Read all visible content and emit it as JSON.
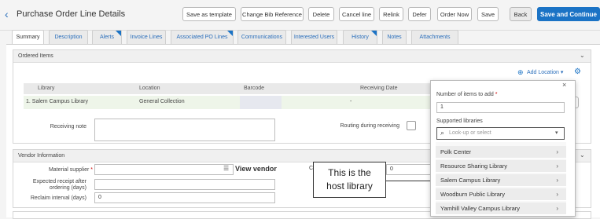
{
  "header": {
    "title": "Purchase Order Line Details",
    "buttons": {
      "save_as_template": "Save as template",
      "change_bib": "Change Bib Reference",
      "delete": "Delete",
      "cancel_line": "Cancel line",
      "relink": "Relink",
      "defer": "Defer",
      "order_now": "Order Now",
      "save": "Save",
      "back": "Back",
      "save_continue": "Save and Continue"
    }
  },
  "tabs": [
    {
      "label": "Summary",
      "active": true
    },
    {
      "label": "Description"
    },
    {
      "label": "Alerts"
    },
    {
      "label": "Invoice Lines"
    },
    {
      "label": "Associated PO Lines"
    },
    {
      "label": "Communications"
    },
    {
      "label": "Interested Users"
    },
    {
      "label": "History"
    },
    {
      "label": "Notes"
    },
    {
      "label": "Attachments"
    }
  ],
  "ordered_items": {
    "section_title": "Ordered Items",
    "add_location": "Add Location",
    "columns": [
      "Library",
      "Location",
      "Barcode",
      "Receiving Date"
    ],
    "row": {
      "library": "1. Salem Campus Library",
      "location": "General Collection",
      "barcode": "-",
      "receiving_date": "-"
    },
    "receiving_note_label": "Receiving note",
    "routing_label": "Routing during receiving"
  },
  "vendor": {
    "section_title": "Vendor Information",
    "material_supplier_label": "Material supplier",
    "view_vendor": "View vendor",
    "expected_receipt_label_1": "Expected receipt after",
    "expected_receipt_label_2": "ordering (days)",
    "reclaim_label": "Reclaim interval (days)",
    "reclaim_value": "0",
    "other_value": "0"
  },
  "popover": {
    "number_label": "Number of items to add",
    "number_value": "1",
    "supported_label": "Supported libraries",
    "search_placeholder": "Look-up or select",
    "libraries": [
      "Polk Center",
      "Resource Sharing Library",
      "Salem Campus Library",
      "Woodburn Public Library",
      "Yamhill Valley Campus Library"
    ]
  },
  "annotation": {
    "line1": "This is the",
    "line2": "host library"
  },
  "colors": {
    "accent": "#1b73c5",
    "row_highlight": "#eef5e9"
  }
}
